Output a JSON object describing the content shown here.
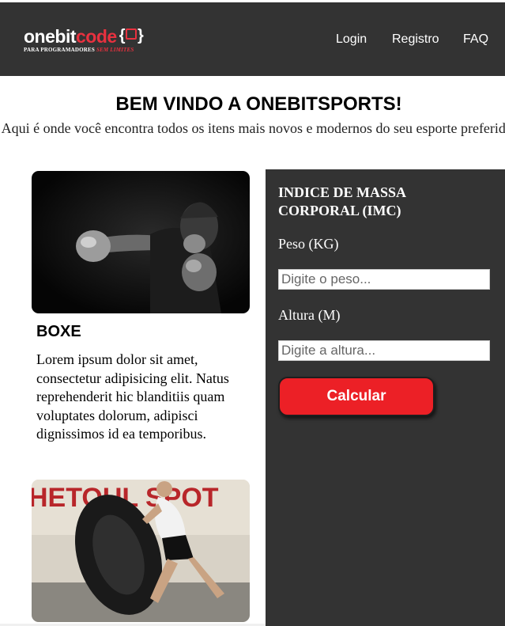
{
  "brand": {
    "logo_white": "onebit",
    "logo_red": "code",
    "badge_open": "{",
    "badge_close": "}",
    "tagline_main": "PARA PROGRAMADORES ",
    "tagline_accent": "SEM LIMITES"
  },
  "nav": {
    "login": "Login",
    "registro": "Registro",
    "faq": "FAQ"
  },
  "hero": {
    "title": "BEM VINDO A ONEBITSPORTS!",
    "subtitle": "Aqui é onde você encontra todos os itens mais novos e modernos do seu esporte preferido."
  },
  "cards": [
    {
      "title": "BOXE",
      "text": "Lorem ipsum dolor sit amet, consectetur adipisicing elit. Natus reprehenderit hic blanditiis quam voluptates dolorum, adipisci dignissimos id ea temporibus."
    },
    {
      "wall_text": "HETOUL SPOT"
    }
  ],
  "imc": {
    "title": "INDICE DE MASSA CORPORAL (IMC)",
    "peso_label": "Peso (KG)",
    "peso_placeholder": "Digite o peso...",
    "altura_label": "Altura (M)",
    "altura_placeholder": "Digite a altura...",
    "button_label": "Calcular"
  },
  "colors": {
    "navbar_bg": "#333333",
    "accent_red": "#ec2026",
    "sidebar_bg": "#333333"
  }
}
